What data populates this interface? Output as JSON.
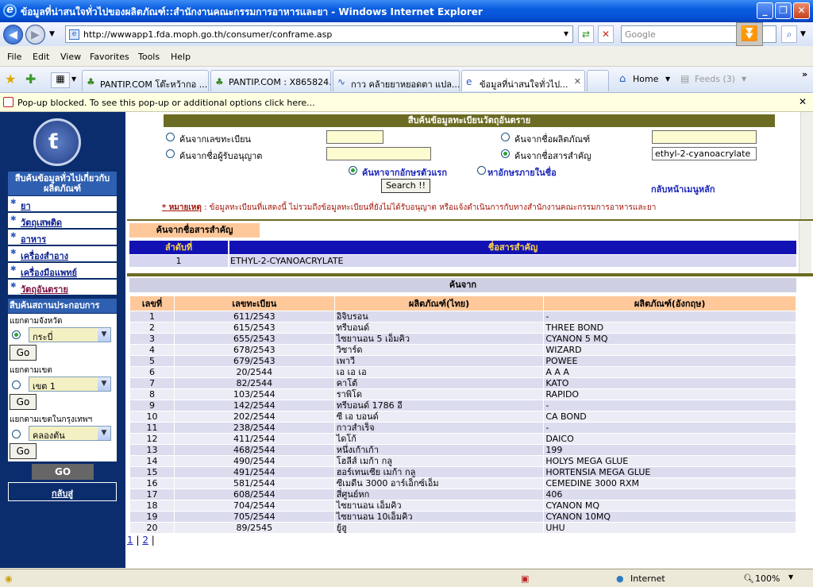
{
  "window": {
    "title": "ข้อมูลที่น่าสนใจทั่วไปของผลิตภัณฑ์::สำนักงานคณะกรรมการอาหารและยา - Windows Internet Explorer",
    "minimize": "_",
    "restore": "❐",
    "close": "✕"
  },
  "address": {
    "url": "http://wwwapp1.fda.moph.go.th/consumer/conframe.asp",
    "search_placeholder": "Google"
  },
  "menu": [
    "File",
    "Edit",
    "View",
    "Favorites",
    "Tools",
    "Help"
  ],
  "tabs": [
    {
      "label": "PANTIP.COM โต๊ะหว้ากอ ..."
    },
    {
      "label": "PANTIP.COM : X865824..."
    },
    {
      "label": "กาว คล้ายยาหยอดตา แปล..."
    },
    {
      "label": "ข้อมูลที่น่าสนใจทั่วไป...",
      "active": true
    }
  ],
  "toolbar": {
    "home": "Home",
    "feeds": "Feeds (3)"
  },
  "popup": {
    "text": "Pop-up blocked. To see this pop-up or additional options click here...",
    "close": "✕"
  },
  "left": {
    "header1": "สืบค้นข้อมูลทั่วไปเกี่ยวกับผลิตภัณฑ์",
    "items": [
      "ยา",
      "วัตถุเสพติด",
      "อาหาร",
      "เครื่องสำอาง",
      "เครื่องมือแพทย์",
      "วัตถุอันตราย"
    ],
    "header2": "สืบค้นสถานประกอบการ",
    "by_province": "แยกตามจังหวัด",
    "province_value": "กระบี่",
    "by_district": "แยกตามเขต",
    "district_value": "เขต 1",
    "by_bkk": "แยกตามเขตในกรุงเทพฯ",
    "bkk_value": "คลองตัน",
    "go": "Go",
    "big_go": "GO",
    "back": "กลับสู่"
  },
  "search": {
    "header": "สืบค้นข้อมูลทะเบียนวัตถุอันตราย",
    "by_reg": "ค้นจากเลขทะเบียน",
    "by_licensee": "ค้นจากชื่อผู้รับอนุญาต",
    "by_product": "ค้นจากชื่อผลิตภัณฑ์",
    "by_substance": "ค้นจากชื่อสารสำคัญ",
    "substance_value": "ethyl-2-cyanoacrylate",
    "opt_first": "ค้นหาจากอักษรตัวแรก",
    "opt_within": "หาอักษรภายในชื่อ",
    "button": "Search !!",
    "back_main": "กลับหน้าเมนูหลัก",
    "note_label": "* หมายเหตุ",
    "note_text": " : ข้อมูลทะเบียนที่แสดงนี้ ไม่รวมถึงข้อมูลทะเบียนที่ยังไม่ได้รับอนุญาต หรือแจ้งดำเนินการกับทางสำนักงานคณะกรรมการอาหารและยา"
  },
  "substance_table": {
    "tag": "ค้นจากชื่อสารสำคัญ",
    "col_no": "ลำดับที่",
    "col_name": "ชื่อสารสำคัญ",
    "row_no": "1",
    "row_name": "ETHYL-2-CYANOACRYLATE"
  },
  "results": {
    "caption": "ค้นจาก",
    "headers": [
      "เลขที่",
      "เลขทะเบียน",
      "ผลิตภัณฑ์(ไทย)",
      "ผลิตภัณฑ์(อังกฤษ)"
    ],
    "rows": [
      [
        "1",
        "611/2543",
        "อิจิบรอน",
        "-"
      ],
      [
        "2",
        "615/2543",
        "ทรีบอนด์",
        "THREE BOND"
      ],
      [
        "3",
        "655/2543",
        "ไซยานอน 5 เอ็มคิว",
        "CYANON 5 MQ"
      ],
      [
        "4",
        "678/2543",
        "วิซาร์ด",
        "WIZARD"
      ],
      [
        "5",
        "679/2543",
        "เพาวี",
        "POWEE"
      ],
      [
        "6",
        "20/2544",
        "เอ เอ เอ",
        "A A A"
      ],
      [
        "7",
        "82/2544",
        "คาโต้",
        "KATO"
      ],
      [
        "8",
        "103/2544",
        "ราพิโด",
        "RAPIDO"
      ],
      [
        "9",
        "142/2544",
        "ทรีบอนด์ 1786 อี",
        "-"
      ],
      [
        "10",
        "202/2544",
        "ซี เอ บอนด์",
        "CA BOND"
      ],
      [
        "11",
        "238/2544",
        "กาวสำเร็จ",
        "-"
      ],
      [
        "12",
        "411/2544",
        "ไดโก้",
        "DAICO"
      ],
      [
        "13",
        "468/2544",
        "หนึ่งเก้าเก้า",
        "199"
      ],
      [
        "14",
        "490/2544",
        "โฮลีส์ เมก้า กลู",
        "HOLYS MEGA GLUE"
      ],
      [
        "15",
        "491/2544",
        "ฮอร์เทนเซีย เมก้า กลู",
        "HORTENSIA MEGA GLUE"
      ],
      [
        "16",
        "581/2544",
        "ซีเมดีน 3000 อาร์เอ็กซ์เอ็ม",
        "CEMEDINE 3000 RXM"
      ],
      [
        "17",
        "608/2544",
        "สี่ศูนย์หก",
        "406"
      ],
      [
        "18",
        "704/2544",
        "ไซยานอน เอ็มคิว",
        "CYANON MQ"
      ],
      [
        "19",
        "705/2544",
        "ไซยานอน 10เอ็มคิว",
        "CYANON 10MQ"
      ],
      [
        "20",
        "89/2545",
        "ยู้ฮู",
        "UHU"
      ]
    ],
    "pages": [
      "1",
      "2"
    ]
  },
  "status": {
    "zone": "Internet",
    "zoom": "100%"
  },
  "colors": {
    "left_bg": "#0b2d6d",
    "header_olive": "#6b6b23",
    "table_head": "#1212b4",
    "peach": "#ffc89a"
  }
}
